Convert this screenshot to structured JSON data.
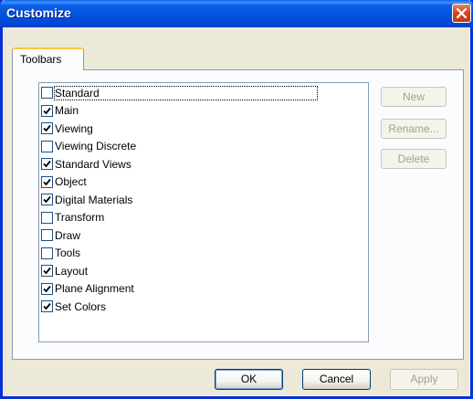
{
  "window": {
    "title": "Customize"
  },
  "tabs": [
    {
      "label": "Toolbars"
    }
  ],
  "toolbars": [
    {
      "label": "Standard",
      "checked": false
    },
    {
      "label": "Main",
      "checked": true
    },
    {
      "label": "Viewing",
      "checked": true
    },
    {
      "label": "Viewing Discrete",
      "checked": false
    },
    {
      "label": "Standard Views",
      "checked": true
    },
    {
      "label": "Object",
      "checked": true
    },
    {
      "label": "Digital Materials",
      "checked": true
    },
    {
      "label": "Transform",
      "checked": false
    },
    {
      "label": "Draw",
      "checked": false
    },
    {
      "label": "Tools",
      "checked": false
    },
    {
      "label": "Layout",
      "checked": true
    },
    {
      "label": "Plane Alignment",
      "checked": true
    },
    {
      "label": "Set Colors",
      "checked": true
    }
  ],
  "side_buttons": {
    "new": "New",
    "rename": "Rename...",
    "delete": "Delete"
  },
  "dialog_buttons": {
    "ok": "OK",
    "cancel": "Cancel",
    "apply": "Apply"
  },
  "icons": {
    "close": "close-icon",
    "check": "check-icon"
  },
  "colors": {
    "title_bar": "#0a5ee5",
    "tab_accent": "#ffc73c",
    "close_button": "#d34a25"
  }
}
